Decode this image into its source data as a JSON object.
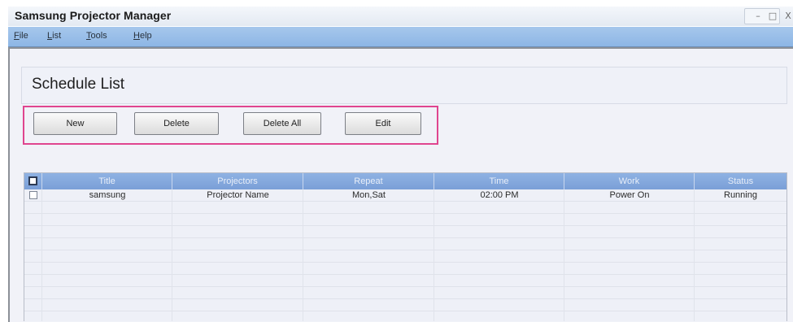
{
  "app": {
    "title": "Samsung Projector Manager",
    "window_controls": {
      "minimize": "–",
      "maximize": "□",
      "close": "X"
    }
  },
  "menu": [
    {
      "label": "File",
      "accel": "F",
      "rest": "ile"
    },
    {
      "label": "List",
      "accel": "L",
      "rest": "ist"
    },
    {
      "label": "Tools",
      "accel": "T",
      "rest": "ools"
    },
    {
      "label": "Help",
      "accel": "H",
      "rest": "elp"
    }
  ],
  "panel": {
    "title": "Schedule List"
  },
  "buttons": {
    "new": "New",
    "delete": "Delete",
    "delete_all": "Delete All",
    "edit": "Edit"
  },
  "table": {
    "columns": [
      "Title",
      "Projectors",
      "Repeat",
      "Time",
      "Work",
      "Status"
    ],
    "rows": [
      {
        "checked": false,
        "title": "samsung",
        "projectors": "Projector Name",
        "repeat": "Mon,Sat",
        "time": "02:00 PM",
        "work": "Power On",
        "status": "Running"
      }
    ]
  },
  "colors": {
    "accent_border": "#e0458f",
    "menubar": "#95bbe7",
    "table_header": "#84a8dd"
  }
}
